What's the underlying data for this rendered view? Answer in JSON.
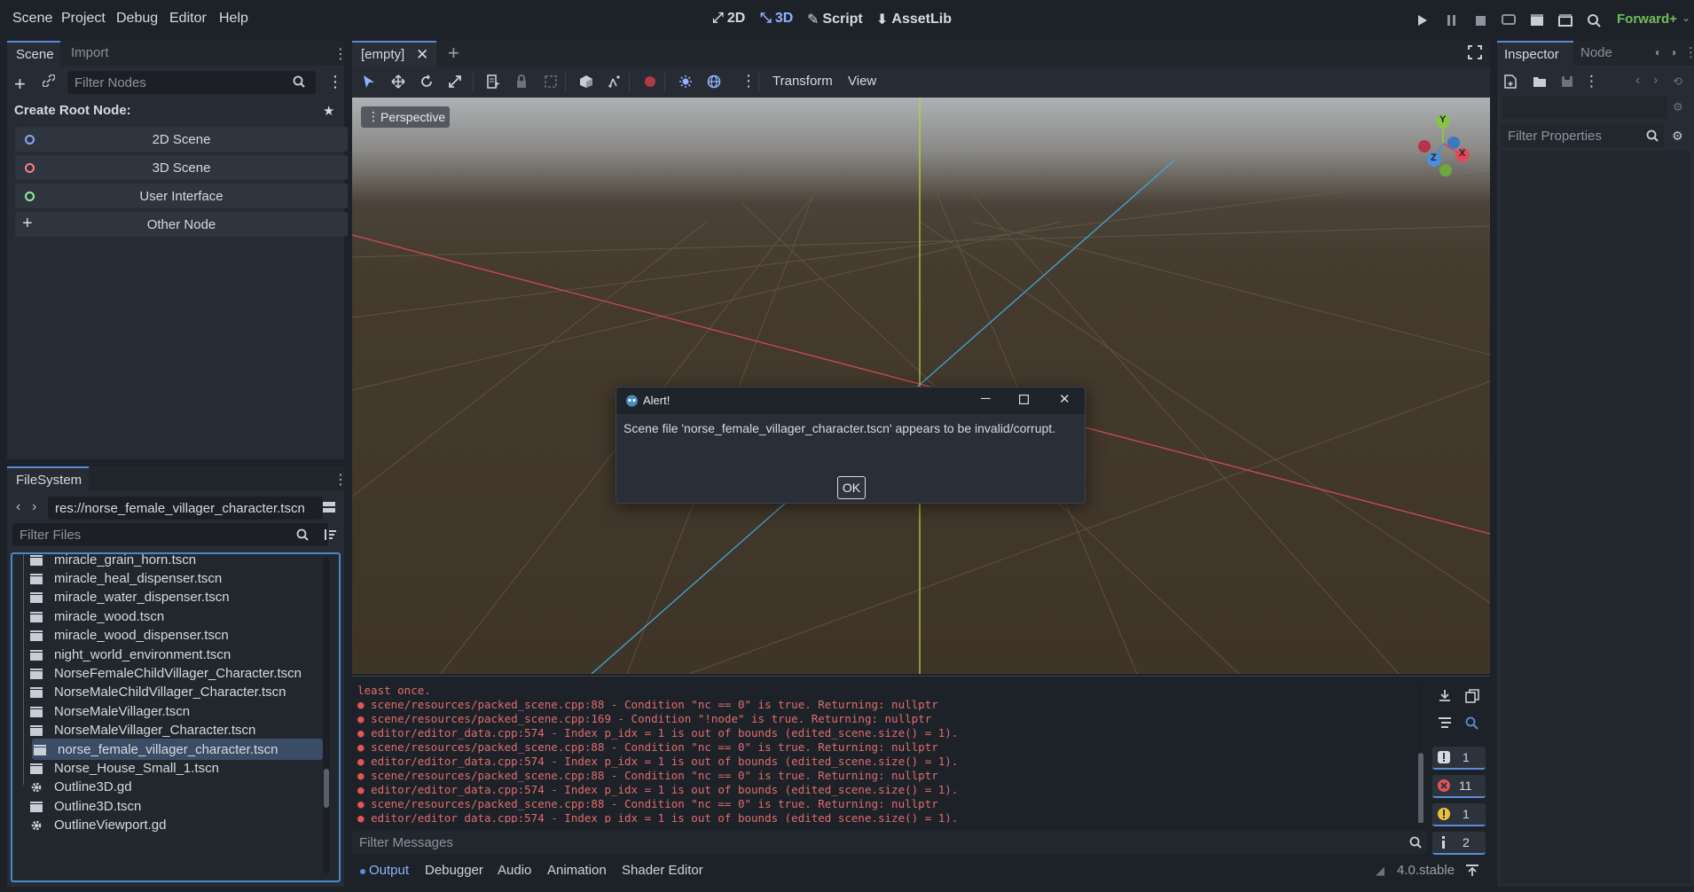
{
  "topbar": {
    "menus": [
      "Scene",
      "Project",
      "Debug",
      "Editor",
      "Help"
    ],
    "workspaces": [
      "2D",
      "3D",
      "Script",
      "AssetLib"
    ],
    "renderer": "Forward+"
  },
  "scene_dock": {
    "tabs": [
      "Scene",
      "Import"
    ],
    "filter_placeholder": "Filter Nodes",
    "create_root_label": "Create Root Node:",
    "root_buttons": [
      "2D Scene",
      "3D Scene",
      "User Interface",
      "Other Node"
    ]
  },
  "filesystem": {
    "tab": "FileSystem",
    "path": "res://norse_female_villager_character.tscn",
    "filter_placeholder": "Filter Files",
    "files": [
      {
        "name": "miracle_grain_horn.tscn",
        "type": "scene"
      },
      {
        "name": "miracle_heal_dispenser.tscn",
        "type": "scene"
      },
      {
        "name": "miracle_water_dispenser.tscn",
        "type": "scene"
      },
      {
        "name": "miracle_wood.tscn",
        "type": "scene"
      },
      {
        "name": "miracle_wood_dispenser.tscn",
        "type": "scene"
      },
      {
        "name": "night_world_environment.tscn",
        "type": "scene"
      },
      {
        "name": "NorseFemaleChildVillager_Character.tscn",
        "type": "scene"
      },
      {
        "name": "NorseMaleChildVillager_Character.tscn",
        "type": "scene"
      },
      {
        "name": "NorseMaleVillager.tscn",
        "type": "scene"
      },
      {
        "name": "NorseMaleVillager_Character.tscn",
        "type": "scene"
      },
      {
        "name": "norse_female_villager_character.tscn",
        "type": "scene",
        "selected": true
      },
      {
        "name": "Norse_House_Small_1.tscn",
        "type": "scene"
      },
      {
        "name": "Outline3D.gd",
        "type": "script"
      },
      {
        "name": "Outline3D.tscn",
        "type": "scene"
      },
      {
        "name": "OutlineViewport.gd",
        "type": "script"
      }
    ]
  },
  "editor": {
    "scene_tab": "[empty]",
    "toolbar_menus": [
      "Transform",
      "View"
    ],
    "view_mode": "Perspective",
    "gizmo_axes": [
      "Y",
      "X",
      "Z"
    ]
  },
  "dialog": {
    "title": "Alert!",
    "message": "Scene file 'norse_female_villager_character.tscn' appears to be invalid/corrupt.",
    "ok_label": "OK"
  },
  "output": {
    "lines": [
      {
        "text": "least once.",
        "bullet": false
      },
      {
        "text": "scene/resources/packed_scene.cpp:88 - Condition \"nc == 0\" is true. Returning: nullptr",
        "bullet": true
      },
      {
        "text": "scene/resources/packed_scene.cpp:169 - Condition \"!node\" is true. Returning: nullptr",
        "bullet": true
      },
      {
        "text": "editor/editor_data.cpp:574 - Index p_idx = 1 is out of bounds (edited_scene.size() = 1).",
        "bullet": true
      },
      {
        "text": "scene/resources/packed_scene.cpp:88 - Condition \"nc == 0\" is true. Returning: nullptr",
        "bullet": true
      },
      {
        "text": "editor/editor_data.cpp:574 - Index p_idx = 1 is out of bounds (edited_scene.size() = 1).",
        "bullet": true
      },
      {
        "text": "scene/resources/packed_scene.cpp:88 - Condition \"nc == 0\" is true. Returning: nullptr",
        "bullet": true
      },
      {
        "text": "editor/editor_data.cpp:574 - Index p_idx = 1 is out of bounds (edited_scene.size() = 1).",
        "bullet": true
      },
      {
        "text": "scene/resources/packed_scene.cpp:88 - Condition \"nc == 0\" is true. Returning: nullptr",
        "bullet": true
      },
      {
        "text": "editor/editor_data.cpp:574 - Index p_idx = 1 is out of bounds (edited_scene.size() = 1).",
        "bullet": true
      }
    ],
    "filter_placeholder": "Filter Messages",
    "counts": {
      "messages": "1",
      "errors": "11",
      "warnings": "1",
      "info": "2"
    }
  },
  "bottom_tabs": [
    "Output",
    "Debugger",
    "Audio",
    "Animation",
    "Shader Editor"
  ],
  "version": "4.0.stable",
  "inspector": {
    "tabs": [
      "Inspector",
      "Node"
    ],
    "filter_placeholder": "Filter Properties"
  }
}
